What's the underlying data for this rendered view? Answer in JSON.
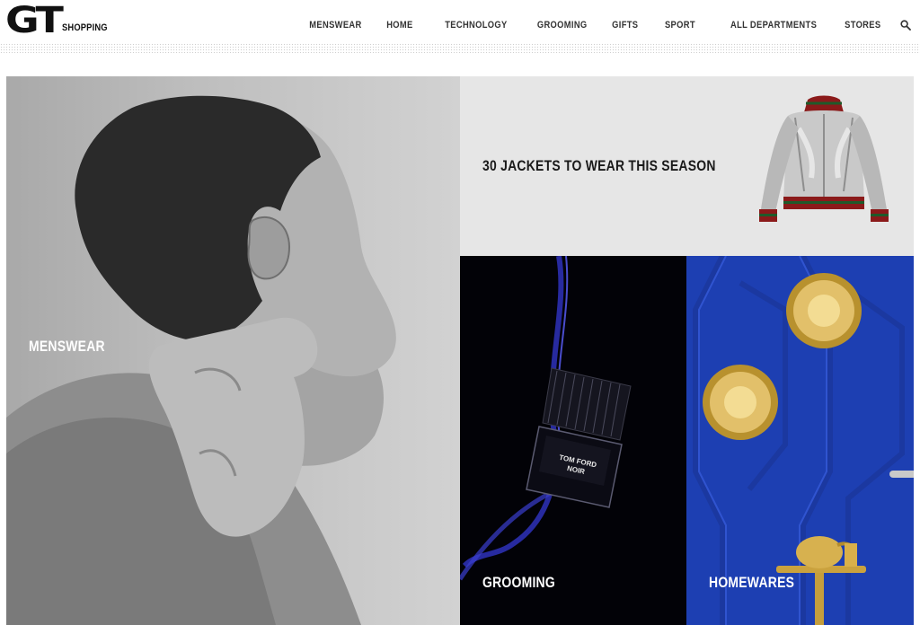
{
  "brand": {
    "logo_mark": "GT",
    "logo_sub": "SHOPPING"
  },
  "nav": {
    "items": [
      "MENSWEAR",
      "HOME",
      "TECHNOLOGY",
      "GROOMING",
      "GIFTS",
      "SPORT",
      "ALL DEPARTMENTS",
      "STORES"
    ],
    "search_icon": "search-icon"
  },
  "tiles": {
    "menswear": "MENSWEAR",
    "jackets": "30 JACKETS TO WEAR THIS SEASON",
    "grooming": "GROOMING",
    "homewares": "HOMEWARES"
  },
  "product_text": {
    "bottle_label": "TOM FORD\nNOIR"
  },
  "colors": {
    "accent_blue": "#1d3fb2",
    "dark": "#020207",
    "light_gray": "#e6e6e6"
  }
}
